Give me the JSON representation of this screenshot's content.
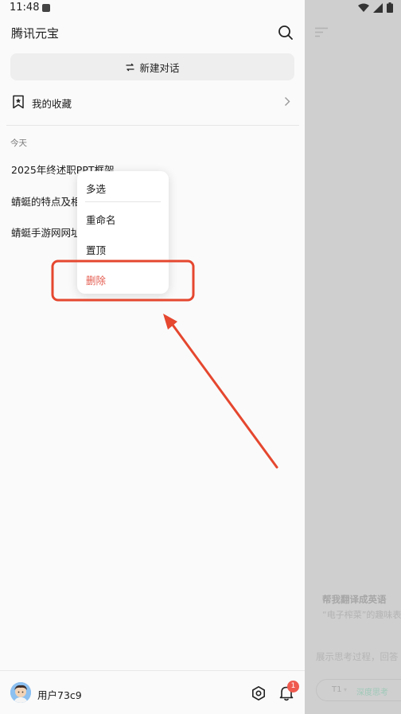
{
  "status_bar": {
    "time": "11:48"
  },
  "app": {
    "title": "腾讯元宝"
  },
  "new_chat": {
    "label": "新建对话"
  },
  "favorites": {
    "label": "我的收藏"
  },
  "history": {
    "section_label": "今天",
    "items": [
      {
        "title": "2025年终述职PPT框架"
      },
      {
        "title": "蜻蜓的特点及相"
      },
      {
        "title": "蜻蜓手游网网址"
      }
    ]
  },
  "context_menu": {
    "items": [
      {
        "label": "多选"
      },
      {
        "label": "重命名"
      },
      {
        "label": "置顶"
      },
      {
        "label": "删除"
      }
    ],
    "delete_color": "#e45b4f"
  },
  "annotation": {
    "highlight_color": "#e5472f",
    "target": "删除"
  },
  "bottom_bar": {
    "username": "用户73c9",
    "notification_count": "1"
  },
  "background_chat": {
    "suggestion_title": "帮我翻译成英语",
    "suggestion_subtitle": "“电子榨菜”的趣味表",
    "think_hint": "展示思考过程，回答",
    "model_label": "T1",
    "deep_think_label": "深度思考"
  }
}
